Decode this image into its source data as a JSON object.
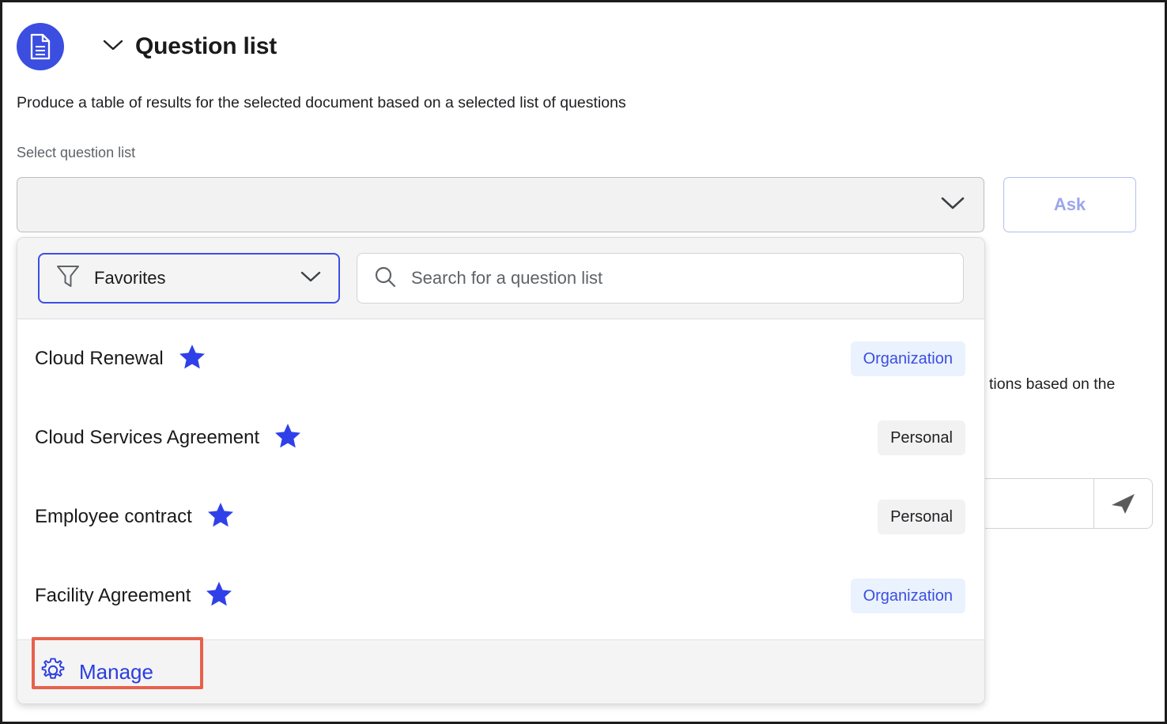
{
  "header": {
    "icon": "document-icon",
    "collapse_icon": "chevron-down-icon",
    "title": "Question list"
  },
  "subtitle": "Produce a table of results for the selected document based on a selected list of questions",
  "select_field": {
    "label": "Select question list",
    "value": "",
    "placeholder": "",
    "chevron_icon": "chevron-down-icon"
  },
  "ask_button": {
    "label": "Ask",
    "state": "disabled"
  },
  "background": {
    "text": "tions based on the",
    "send_icon": "send-icon",
    "input_value": ""
  },
  "dropdown": {
    "filter": {
      "icon": "filter-icon",
      "label": "Favorites",
      "chevron_icon": "chevron-down-icon"
    },
    "search": {
      "icon": "search-icon",
      "placeholder": "Search for a question list",
      "value": ""
    },
    "items": [
      {
        "name": "Cloud Renewal",
        "favorite_icon": "star-icon",
        "badge": "Organization",
        "badge_type": "org"
      },
      {
        "name": "Cloud Services Agreement",
        "favorite_icon": "star-icon",
        "badge": "Personal",
        "badge_type": "personal"
      },
      {
        "name": "Employee contract",
        "favorite_icon": "star-icon",
        "badge": "Personal",
        "badge_type": "personal"
      },
      {
        "name": "Facility Agreement",
        "favorite_icon": "star-icon",
        "badge": "Organization",
        "badge_type": "org"
      }
    ],
    "footer": {
      "icon": "gear-icon",
      "label": "Manage",
      "highlighted": true
    }
  },
  "colors": {
    "brand_blue": "#3b4ee0",
    "link_blue": "#2a3de0",
    "badge_org_bg": "#eaf2fe",
    "badge_personal_bg": "#f2f2f2",
    "highlight_red": "#e8604c",
    "focus_border": "#3d4fe3"
  }
}
